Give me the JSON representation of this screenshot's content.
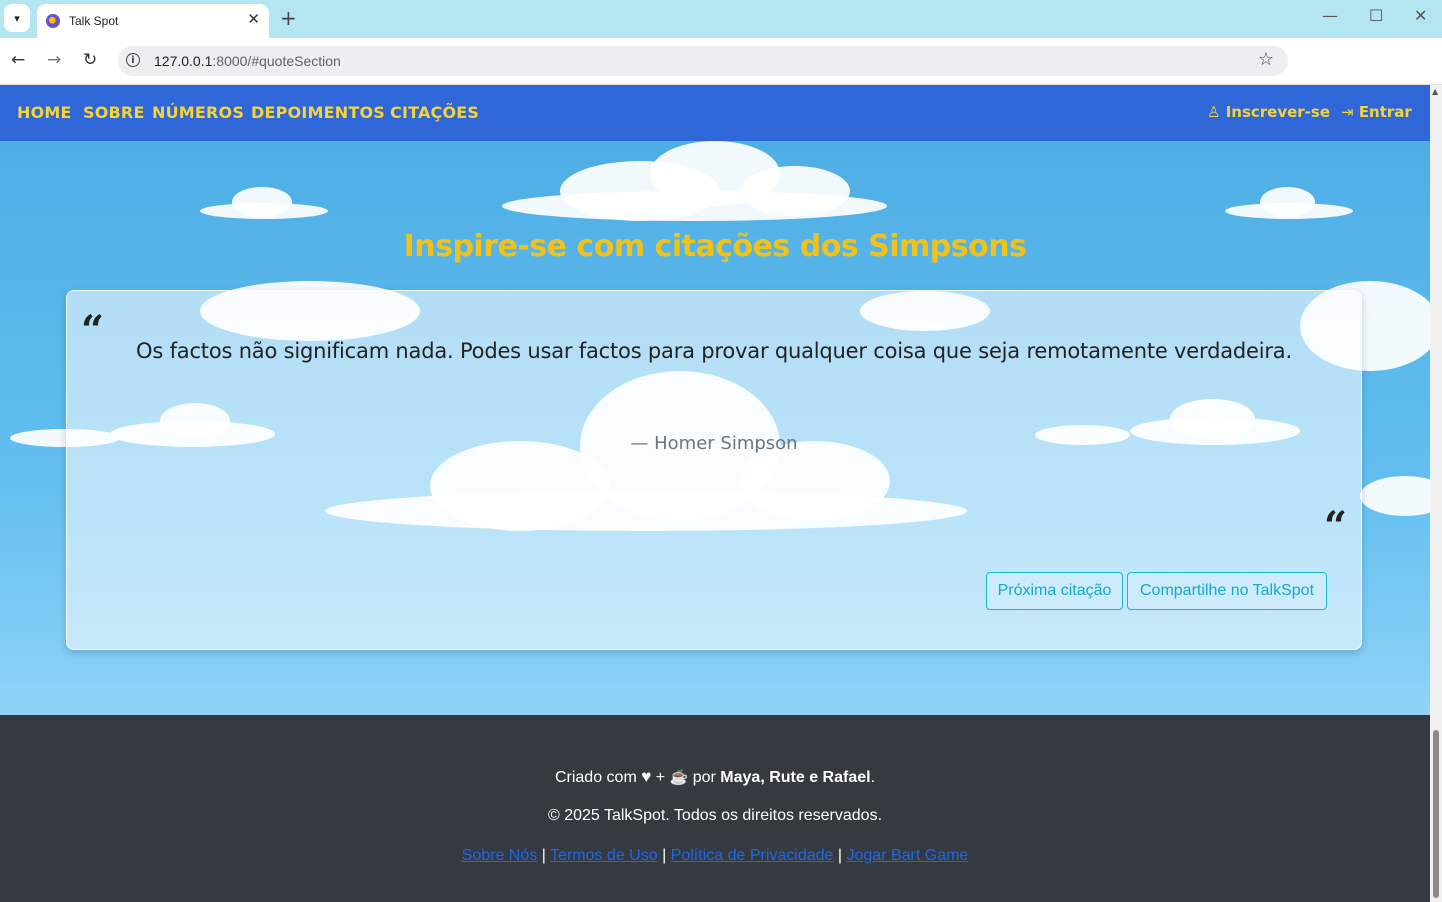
{
  "browser": {
    "tab_title": "Talk Spot",
    "url_host": "127.0.0.1",
    "url_rest": ":8000/#quoteSection"
  },
  "nav": {
    "links": [
      "HOME",
      "SOBRE",
      "NÚMEROS",
      "DEPOIMENTOS",
      "CITAÇÕES"
    ],
    "signup": "Inscrever-se",
    "login": "Entrar"
  },
  "section": {
    "title": "Inspire-se com citações dos Simpsons"
  },
  "quote": {
    "text": "Os factos não significam nada. Podes usar factos para provar qualquer coisa que seja remotamente verdadeira.",
    "author": "— Homer Simpson",
    "next_button": "Próxima citação",
    "share_button": "Compartilhe no TalkSpot"
  },
  "footer": {
    "created_prefix": "Criado com",
    "created_plus": "+",
    "created_by": "por",
    "authors": "Maya, Rute e Rafael",
    "created_suffix": ".",
    "copyright": "© 2025 TalkSpot. Todos os direitos reservados.",
    "links": [
      "Sobre Nós",
      "Termos de Uso",
      "Política de Privacidade",
      "Jogar Bart Game"
    ],
    "separator": "|"
  },
  "colors": {
    "navbar": "#2f66d8",
    "accent_yellow": "#f5d33a",
    "button_teal": "#17b8d0",
    "footer_bg": "#343a40"
  },
  "icons": [
    "heart-icon",
    "coffee-icon",
    "user-icon",
    "login-icon",
    "quote-open-icon",
    "quote-close-icon"
  ]
}
